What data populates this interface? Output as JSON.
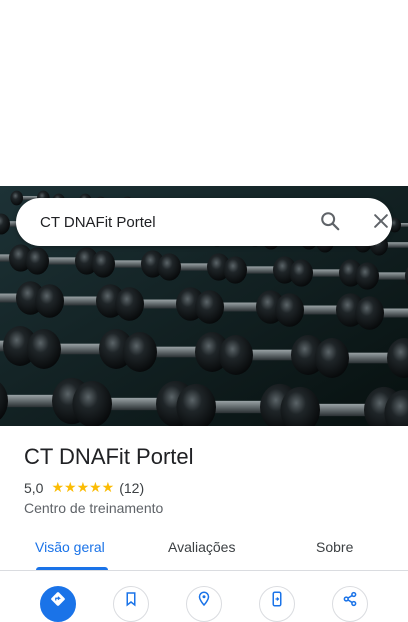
{
  "search": {
    "value": "CT DNAFit Portel"
  },
  "place": {
    "name": "CT DNAFit Portel",
    "rating": "5,0",
    "stars": "★★★★★",
    "review_count": "(12)",
    "category": "Centro de treinamento"
  },
  "tabs": [
    {
      "label": "Visão geral",
      "active": true
    },
    {
      "label": "Avaliações",
      "active": false
    },
    {
      "label": "Sobre",
      "active": false
    }
  ],
  "actions": [
    {
      "icon": "directions-icon"
    },
    {
      "icon": "bookmark-icon"
    },
    {
      "icon": "nearby-icon"
    },
    {
      "icon": "send-to-phone-icon"
    },
    {
      "icon": "share-icon"
    }
  ],
  "colors": {
    "accent": "#1a73e8",
    "stars": "#fbbc04"
  }
}
